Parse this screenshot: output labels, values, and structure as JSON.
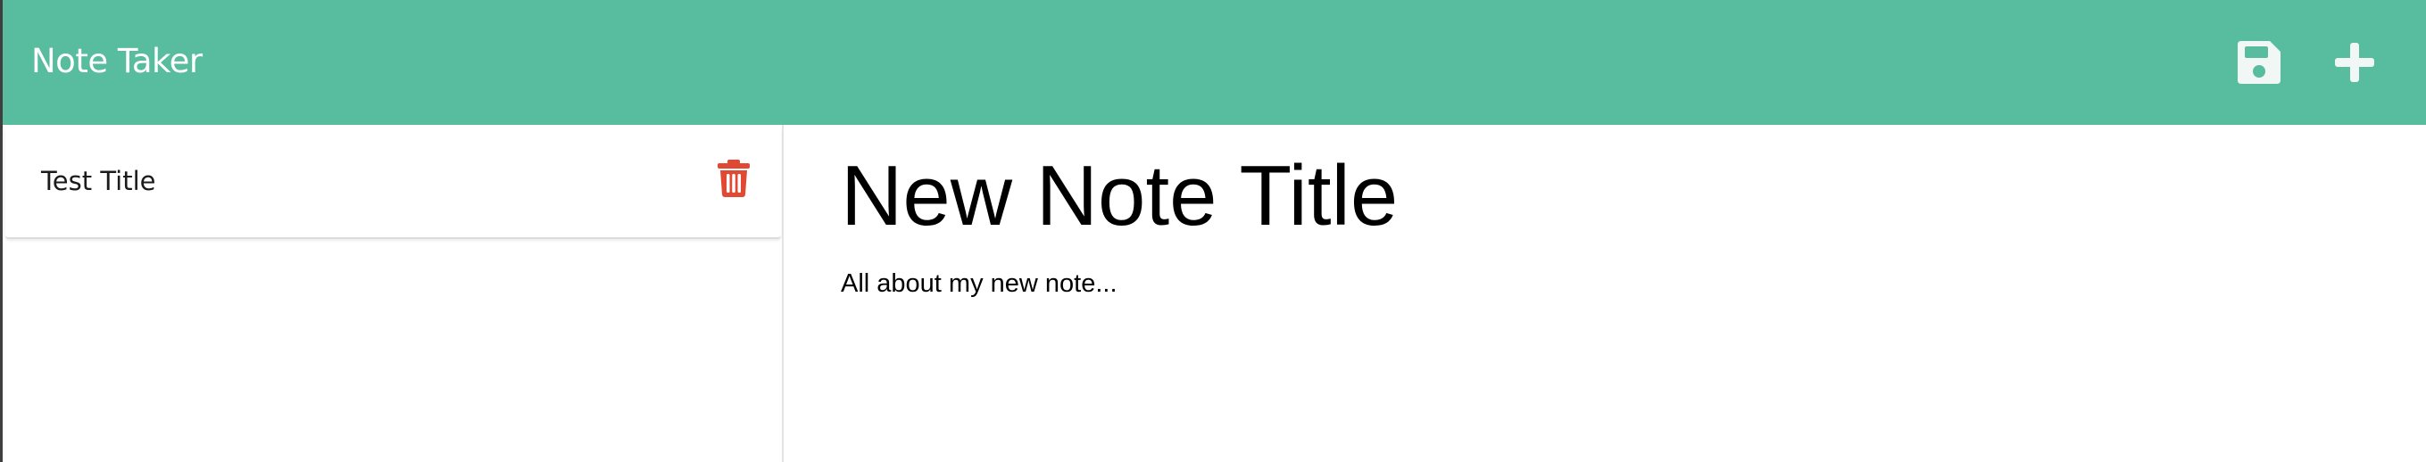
{
  "navbar": {
    "brand": "Note Taker",
    "background_color": "#58bc9f",
    "icons": {
      "save": "save-icon",
      "new": "plus-icon"
    }
  },
  "notes_list": {
    "items": [
      {
        "title": "Test Title",
        "action_icon": "trash-icon",
        "action_color": "#e04a35"
      }
    ]
  },
  "editor": {
    "title_placeholder": "New Note Title",
    "text_placeholder": "All about my new note..."
  }
}
